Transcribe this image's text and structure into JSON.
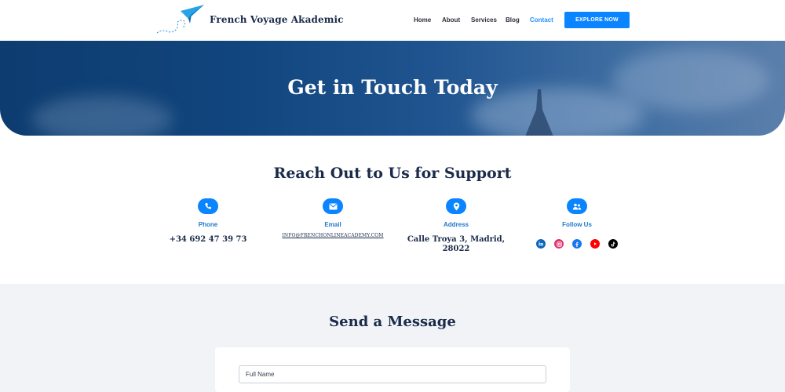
{
  "header": {
    "brand": "French Voyage Akademic",
    "nav": [
      {
        "label": "Home",
        "active": false
      },
      {
        "label": "About",
        "active": false
      },
      {
        "label": "Services",
        "active": false
      },
      {
        "label": "Blog",
        "active": false
      },
      {
        "label": "Contact",
        "active": true
      }
    ],
    "cta_label": "EXPLORE NOW"
  },
  "hero": {
    "title": "Get in Touch Today"
  },
  "support": {
    "title": "Reach Out to Us for Support",
    "columns": [
      {
        "icon": "phone-icon",
        "label": "Phone",
        "value": "+34 692 47 39 73"
      },
      {
        "icon": "email-icon",
        "label": "Email",
        "value": "INFO@FRENCHONLINEACADEMY.COM"
      },
      {
        "icon": "location-pin-icon",
        "label": "Address",
        "value": "Calle Troya 3, Madrid, 28022"
      },
      {
        "icon": "people-icon",
        "label": "Follow Us",
        "value": ""
      }
    ],
    "socials": [
      {
        "icon": "linkedin-icon",
        "color": "#0a66c2"
      },
      {
        "icon": "instagram-icon",
        "color": "#e1306c"
      },
      {
        "icon": "facebook-icon",
        "color": "#1877f2"
      },
      {
        "icon": "youtube-icon",
        "color": "#ff0000"
      },
      {
        "icon": "tiktok-icon",
        "color": "#000000"
      }
    ]
  },
  "message": {
    "title": "Send a Message",
    "full_name_placeholder": "Full Name"
  },
  "colors": {
    "accent": "#0b84ff",
    "heading": "#1b2b4a",
    "hero_dark": "#0d3c70",
    "section_bg": "#f1f3f7"
  }
}
